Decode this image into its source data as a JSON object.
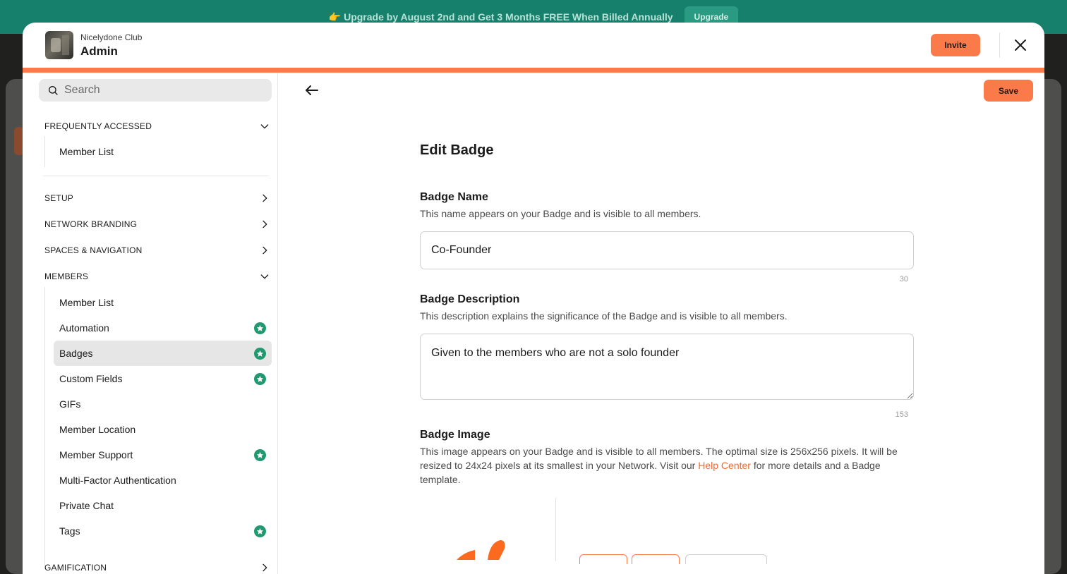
{
  "banner": {
    "text": "👉 Upgrade by August 2nd and Get 3 Months FREE When Billed Annually",
    "button": "Upgrade"
  },
  "header": {
    "club_name": "Nicelydone Club",
    "title": "Admin",
    "invite_label": "Invite"
  },
  "search": {
    "placeholder": "Search"
  },
  "sidebar": {
    "frequently_accessed": {
      "title": "FREQUENTLY ACCESSED",
      "items": [
        "Member List"
      ]
    },
    "setup": "SETUP",
    "network_branding": "NETWORK BRANDING",
    "spaces_navigation": "SPACES & NAVIGATION",
    "members": {
      "title": "MEMBERS",
      "items": [
        {
          "label": "Member List",
          "badge": false
        },
        {
          "label": "Automation",
          "badge": true
        },
        {
          "label": "Badges",
          "badge": true,
          "active": true
        },
        {
          "label": "Custom Fields",
          "badge": true
        },
        {
          "label": "GIFs",
          "badge": false
        },
        {
          "label": "Member Location",
          "badge": false
        },
        {
          "label": "Member Support",
          "badge": true
        },
        {
          "label": "Multi-Factor Authentication",
          "badge": false
        },
        {
          "label": "Private Chat",
          "badge": false
        },
        {
          "label": "Tags",
          "badge": true
        }
      ]
    },
    "gamification": "GAMIFICATION"
  },
  "toolbar": {
    "save_label": "Save"
  },
  "form": {
    "title": "Edit Badge",
    "name": {
      "label": "Badge Name",
      "description": "This name appears on your Badge and is visible to all members.",
      "value": "Co-Founder",
      "counter": "30"
    },
    "description": {
      "label": "Badge Description",
      "description": "This description explains the significance of the Badge and is visible to all members.",
      "value": "Given to the members who are not a solo founder",
      "counter": "153"
    },
    "image": {
      "label": "Badge Image",
      "description_before": "This image appears on your Badge and is visible to all members. The optimal size is 256x256 pixels. It will be resized to 24x24 pixels at its smallest in your Network. Visit our ",
      "link": "Help Center",
      "description_after": " for more details and a Badge template."
    }
  },
  "colors": {
    "accent": "#fb7a4a",
    "badge": "#1f9a6f",
    "banner": "#17806d"
  }
}
